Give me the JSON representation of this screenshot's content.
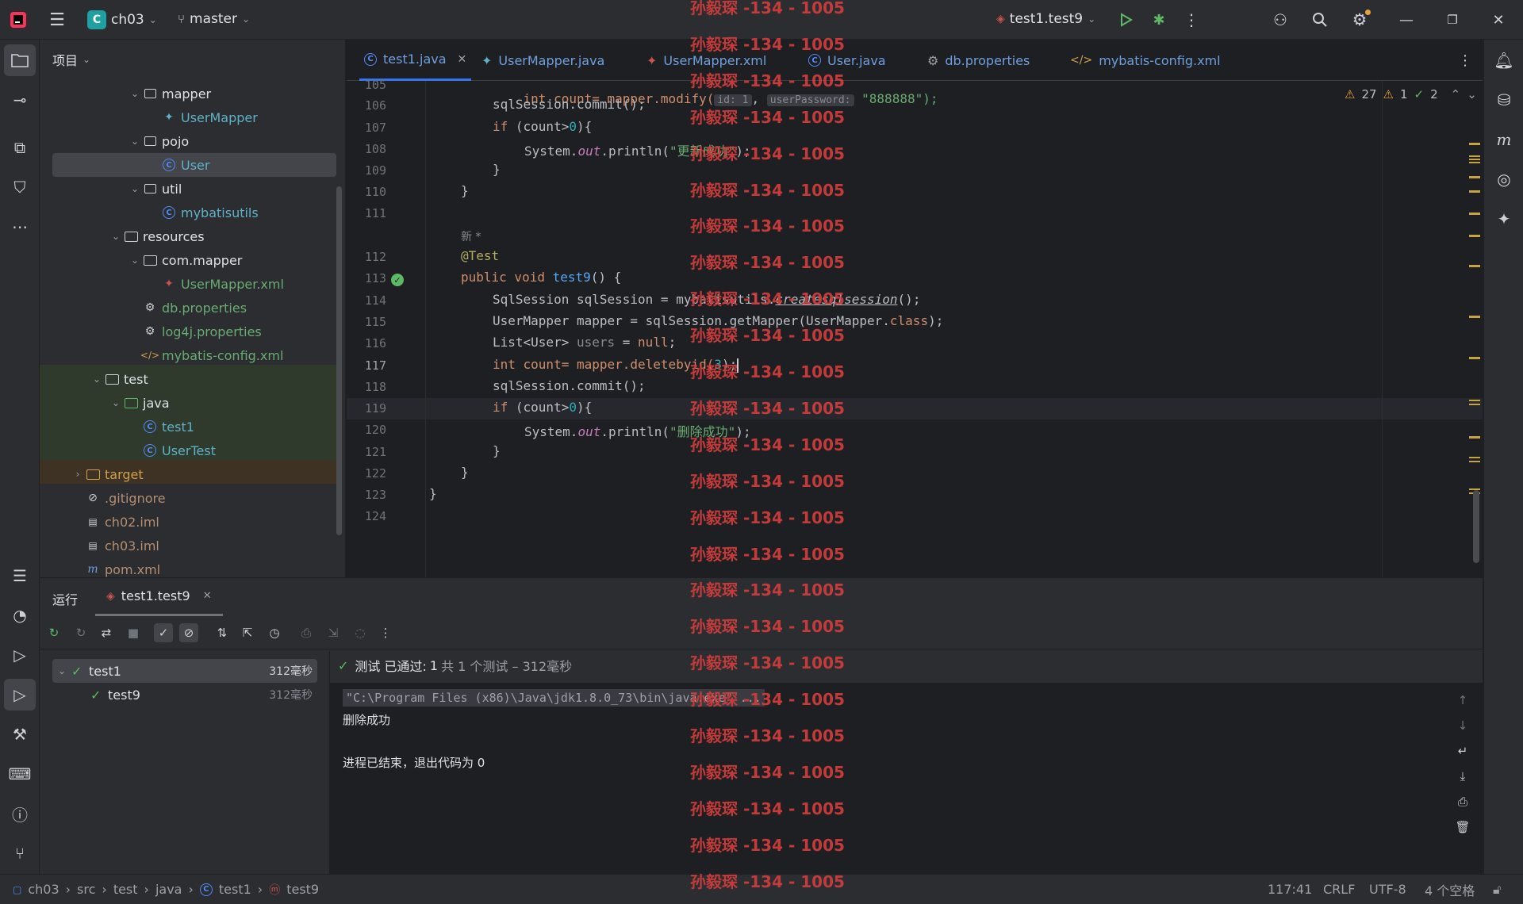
{
  "titlebar": {
    "project_badge": "C",
    "project_name": "ch03",
    "branch": "master",
    "run_config": "test1.test9"
  },
  "project_panel": {
    "title": "项目",
    "tree": [
      {
        "label": "mapper",
        "type": "package",
        "depth": 4,
        "expanded": true
      },
      {
        "label": "UserMapper",
        "type": "mapper-interface",
        "depth": 5
      },
      {
        "label": "pojo",
        "type": "package",
        "depth": 4,
        "expanded": true
      },
      {
        "label": "User",
        "type": "class",
        "depth": 5,
        "selected": true
      },
      {
        "label": "util",
        "type": "package",
        "depth": 4,
        "expanded": true
      },
      {
        "label": "mybatisutils",
        "type": "class",
        "depth": 5
      },
      {
        "label": "resources",
        "type": "resources-folder",
        "depth": 3,
        "expanded": true
      },
      {
        "label": "com.mapper",
        "type": "folder",
        "depth": 4,
        "expanded": true
      },
      {
        "label": "UserMapper.xml",
        "type": "mapper-xml",
        "depth": 5
      },
      {
        "label": "db.properties",
        "type": "properties",
        "depth": 4
      },
      {
        "label": "log4j.properties",
        "type": "properties",
        "depth": 4
      },
      {
        "label": "mybatis-config.xml",
        "type": "xml",
        "depth": 4
      },
      {
        "label": "test",
        "type": "folder",
        "depth": 2,
        "expanded": true
      },
      {
        "label": "java",
        "type": "test-folder",
        "depth": 3,
        "expanded": true
      },
      {
        "label": "test1",
        "type": "class",
        "depth": 4
      },
      {
        "label": "UserTest",
        "type": "class",
        "depth": 4
      },
      {
        "label": "target",
        "type": "excluded-folder",
        "depth": 1,
        "expanded": false
      },
      {
        "label": ".gitignore",
        "type": "ignore",
        "depth": 1
      },
      {
        "label": "ch02.iml",
        "type": "iml",
        "depth": 1
      },
      {
        "label": "ch03.iml",
        "type": "iml",
        "depth": 1
      },
      {
        "label": "pom.xml",
        "type": "maven",
        "depth": 1
      }
    ]
  },
  "editor": {
    "tabs": [
      {
        "label": "test1.java",
        "active": true
      },
      {
        "label": "UserMapper.java"
      },
      {
        "label": "UserMapper.xml"
      },
      {
        "label": "User.java"
      },
      {
        "label": "db.properties"
      },
      {
        "label": "mybatis-config.xml"
      }
    ],
    "inspections": {
      "warnings": "27",
      "weak_warnings": "1",
      "ok": "2"
    },
    "current_line": "117",
    "author_hint": "新 *",
    "lines": [
      {
        "no": "105"
      },
      {
        "no": "106"
      },
      {
        "no": "107"
      },
      {
        "no": "108"
      },
      {
        "no": "109"
      },
      {
        "no": "110"
      },
      {
        "no": "111"
      },
      {
        "no": "112"
      },
      {
        "no": "113"
      },
      {
        "no": "114"
      },
      {
        "no": "115"
      },
      {
        "no": "116"
      },
      {
        "no": "117"
      },
      {
        "no": "118"
      },
      {
        "no": "119"
      },
      {
        "no": "120"
      },
      {
        "no": "121"
      },
      {
        "no": "122"
      },
      {
        "no": "123"
      },
      {
        "no": "124"
      }
    ],
    "code": {
      "l105a": "int count= mapper.modify(",
      "l105_hint1": "id: 1",
      "l105_hint2": "userPassword:",
      "l105b": "\"888888\");",
      "l106": "sqlSession.commit();",
      "l107a": "if",
      "l107b": " (count>",
      "l107c": "0",
      "l107d": "){",
      "l108a": "System.",
      "l108b": "out",
      "l108c": ".println(",
      "l108d": "\"更新成功\"",
      "l108e": ");",
      "l109": "}",
      "l110": "}",
      "l112": "@Test",
      "l113a": "public void ",
      "l113b": "test9",
      "l113c": "() {",
      "l114a": "SqlSession sqlSession = mybatisutils.",
      "l114b": "createsqlsession",
      "l114c": "();",
      "l115a": "UserMapper mapper = sqlSession.getMapper(UserMapper.",
      "l115b": "class",
      "l115c": ");",
      "l116a": "List<User> ",
      "l116b": "users",
      "l116c": " = ",
      "l116d": "null",
      "l116e": ";",
      "l117a": "int count= mapper.deletebyid(",
      "l117b": "3",
      "l117c": ");",
      "l118": "sqlSession.commit();",
      "l119a": "if",
      "l119b": " (count>",
      "l119c": "0",
      "l119d": "){",
      "l120a": "System.",
      "l120b": "out",
      "l120c": ".println(",
      "l120d": "\"删除成功\"",
      "l120e": ");",
      "l121": "}",
      "l122": "}",
      "l123": "}"
    }
  },
  "run_panel": {
    "title": "运行",
    "tab": "test1.test9",
    "tests": [
      {
        "name": "test1",
        "time": "312毫秒"
      },
      {
        "name": "test9",
        "time": "312毫秒"
      }
    ],
    "status_label": "测试 已通过:",
    "status_count": "1",
    "status_detail": "共 1 个测试 – 312毫秒",
    "console": [
      "\"C:\\Program Files (x86)\\Java\\jdk1.8.0_73\\bin\\java.exe\" ...",
      "删除成功",
      "",
      "进程已结束，退出代码为 0"
    ]
  },
  "statusbar": {
    "breadcrumbs": [
      "ch03",
      "src",
      "test",
      "java",
      "test1",
      "test9"
    ],
    "position": "117:41",
    "line_sep": "CRLF",
    "encoding": "UTF-8",
    "indent": "4 个空格"
  },
  "watermark": {
    "text": "孙毅琛 -134 - 1005"
  },
  "colors": {
    "accent": "#3574f0",
    "watermark": "#d13d3d",
    "pass": "#5fb865"
  }
}
